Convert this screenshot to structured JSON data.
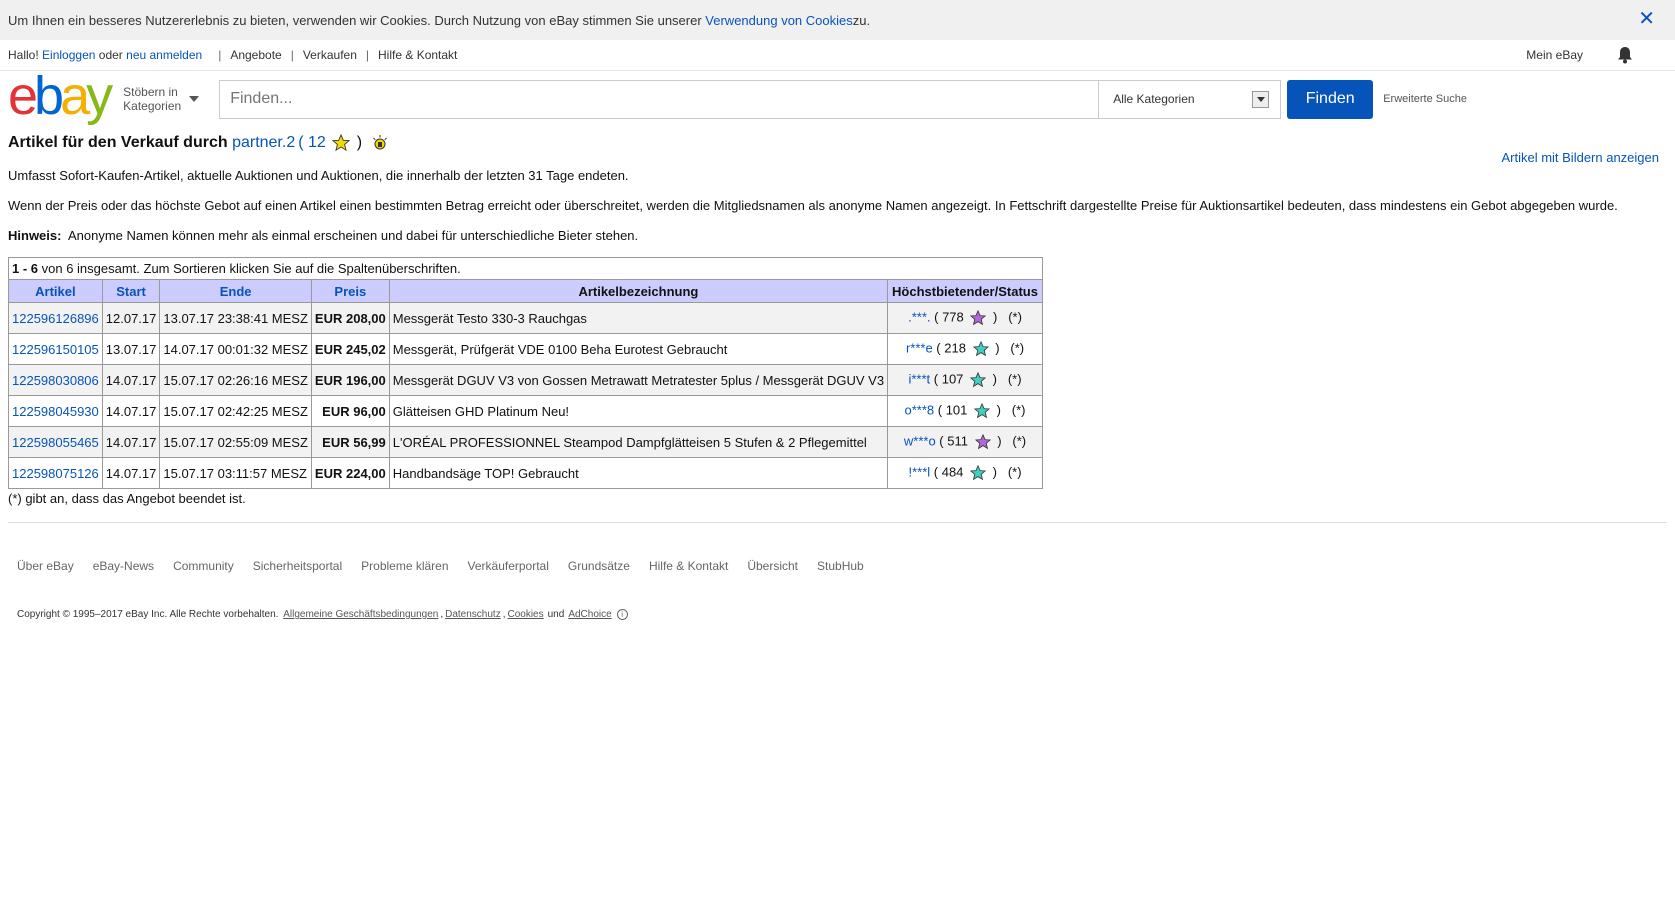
{
  "cookie": {
    "text": "Um Ihnen ein besseres Nutzererlebnis zu bieten, verwenden wir Cookies. Durch Nutzung von eBay stimmen Sie unserer ",
    "link": "Verwendung von Cookies",
    "suffix": " zu.",
    "close": "✕"
  },
  "topnav": {
    "hello": "Hallo!",
    "login": "Einloggen",
    "or": "oder",
    "register": "neu anmelden",
    "offers": "Angebote",
    "sell": "Verkaufen",
    "help": "Hilfe & Kontakt",
    "my_ebay": "Mein eBay"
  },
  "header": {
    "logo": {
      "e": "e",
      "b": "b",
      "a": "a",
      "y": "y"
    },
    "browse_line1": "Stöbern in",
    "browse_line2": "Kategorien",
    "search_placeholder": "Finden...",
    "category": "Alle Kategorien",
    "find_button": "Finden",
    "advanced": "Erweiterte Suche"
  },
  "main": {
    "title_prefix": "Artikel für den Verkauf durch",
    "seller": "partner.2",
    "open_paren": "(",
    "feedback": "12",
    "close_paren": ")",
    "show_images": "Artikel mit Bildern anzeigen",
    "para1": "Umfasst Sofort-Kaufen-Artikel, aktuelle Auktionen und Auktionen, die innerhalb der letzten 31 Tage endeten.",
    "para2": "Wenn der Preis oder das höchste Gebot auf einen Artikel einen bestimmten Betrag erreicht oder überschreitet, werden die Mitgliedsnamen als anonyme Namen angezeigt. In Fettschrift dargestellte Preise für Auktionsartikel bedeuten, dass mindestens ein Gebot abgegeben wurde.",
    "hint_label": "Hinweis:",
    "hint_text": "Anonyme Namen können mehr als einmal erscheinen und dabei für unterschiedliche Bieter stehen."
  },
  "table": {
    "summary_range": "1 - 6",
    "summary_text": " von 6 insgesamt. Zum Sortieren klicken Sie auf die Spaltenüberschriften.",
    "headers": [
      "Artikel",
      "Start",
      "Ende",
      "Preis",
      "Artikelbezeichnung",
      "Höchstbietender/Status"
    ],
    "rows": [
      {
        "id": "122596126896",
        "start": "12.07.17",
        "end": "13.07.17 23:38:41 MESZ",
        "price": "EUR 208,00",
        "title": "Messgerät Testo 330-3 Rauchgas",
        "bidder": ".***.",
        "score": "778",
        "star": "purple",
        "status": "(*)"
      },
      {
        "id": "122596150105",
        "start": "13.07.17",
        "end": "14.07.17 00:01:32 MESZ",
        "price": "EUR 245,02",
        "title": "Messgerät, Prüfgerät VDE 0100 Beha Eurotest Gebraucht",
        "bidder": "r***e",
        "score": "218",
        "star": "turquoise",
        "status": "(*)"
      },
      {
        "id": "122598030806",
        "start": "14.07.17",
        "end": "15.07.17 02:26:16 MESZ",
        "price": "EUR 196,00",
        "title": "Messgerät DGUV V3 von Gossen Metrawatt Metratester 5plus / Messgerät DGUV V3",
        "bidder": "i***t",
        "score": "107",
        "star": "turquoise",
        "status": "(*)"
      },
      {
        "id": "122598045930",
        "start": "14.07.17",
        "end": "15.07.17 02:42:25 MESZ",
        "price": "EUR 96,00",
        "title": "Glätteisen GHD Platinum Neu!",
        "bidder": "o***8",
        "score": "101",
        "star": "turquoise",
        "status": "(*)"
      },
      {
        "id": "122598055465",
        "start": "14.07.17",
        "end": "15.07.17 02:55:09 MESZ",
        "price": "EUR 56,99",
        "title": "L'ORÉAL PROFESSIONNEL Steampod Dampfglätteisen 5 Stufen & 2 Pflegemittel",
        "bidder": "w***o",
        "score": "511",
        "star": "purple",
        "status": "(*)"
      },
      {
        "id": "122598075126",
        "start": "14.07.17",
        "end": "15.07.17 03:11:57 MESZ",
        "price": "EUR 224,00",
        "title": "Handbandsäge TOP! Gebraucht",
        "bidder": "!***l",
        "score": "484",
        "star": "turquoise",
        "status": "(*)"
      }
    ],
    "footnote": "(*) gibt an, dass das Angebot beendet ist."
  },
  "footer": {
    "links": [
      "Über eBay",
      "eBay-News",
      "Community",
      "Sicherheitsportal",
      "Probleme klären",
      "Verkäuferportal",
      "Grundsätze",
      "Hilfe & Kontakt",
      "Übersicht",
      "StubHub"
    ],
    "copyright": "Copyright © 1995–2017 eBay Inc. Alle Rechte vorbehalten.",
    "agb": "Allgemeine Geschäftsbedingungen",
    "privacy": "Datenschutz",
    "cookies": "Cookies",
    "and": "und",
    "adchoice": "AdChoice"
  },
  "colors": {
    "link": "#0654ba",
    "header_bg": "#ccccff",
    "star_yellow": "#f5d800",
    "star_purple": "#b366d9",
    "star_turquoise": "#3fd0c0"
  }
}
